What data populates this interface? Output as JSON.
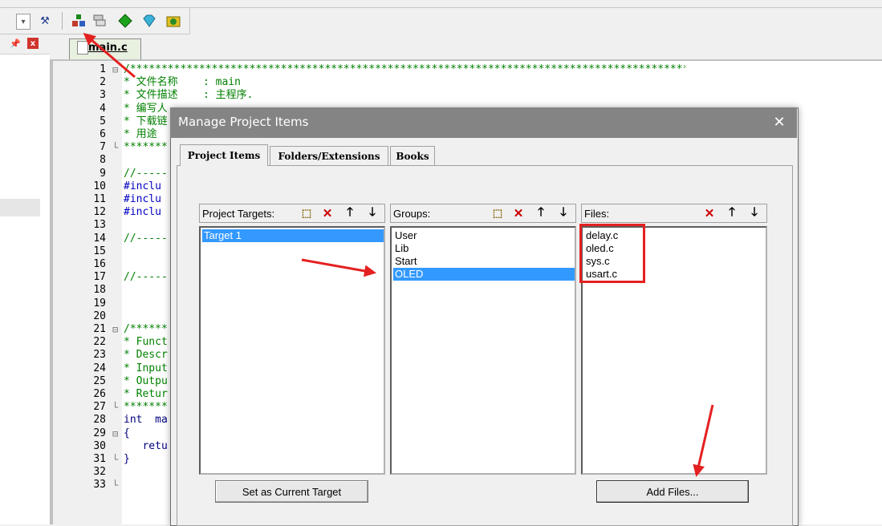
{
  "editor": {
    "tab_label": "main.c",
    "line_numbers": [
      "1",
      "2",
      "3",
      "4",
      "5",
      "6",
      "7",
      "8",
      "9",
      "10",
      "11",
      "12",
      "13",
      "14",
      "15",
      "16",
      "17",
      "18",
      "19",
      "20",
      "21",
      "22",
      "23",
      "24",
      "25",
      "26",
      "27",
      "28",
      "29",
      "30",
      "31",
      "32",
      "33"
    ],
    "code_lines": [
      "/*****************************************************************************************",
      "* 文件名称    : main",
      "* 文件描述    : 主程序.",
      "* 编写人",
      "* 下载链",
      "* 用途",
      "*******",
      "",
      "//-----",
      "#inclu",
      "#inclu",
      "#inclu",
      "",
      "//-----",
      "",
      "",
      "//-----",
      "",
      "",
      "",
      "/******",
      "* Funct",
      "* Descr",
      "* Input",
      "* Outpu",
      "* Retur",
      "*******",
      "int  ma",
      "{",
      "   retu",
      "}",
      "",
      ""
    ]
  },
  "dialog": {
    "title": "Manage Project Items",
    "tabs": [
      {
        "label": "Project Items",
        "active": true
      },
      {
        "label": "Folders/Extensions",
        "active": false
      },
      {
        "label": "Books",
        "active": false
      }
    ],
    "targets": {
      "header": "Project Targets:",
      "items": [
        "Target 1"
      ],
      "selected": "Target 1"
    },
    "groups": {
      "header": "Groups:",
      "items": [
        "User",
        "Lib",
        "Start",
        "OLED"
      ],
      "selected": "OLED"
    },
    "files": {
      "header": "Files:",
      "items": [
        "delay.c",
        "oled.c",
        "sys.c",
        "usart.c"
      ]
    },
    "set_target_button": "Set as Current Target",
    "add_files_button": "Add Files..."
  },
  "colors": {
    "selection": "#3399ff",
    "annotation_red": "#e52020",
    "comment_green": "#008000",
    "dialog_title_bg": "#848484"
  }
}
